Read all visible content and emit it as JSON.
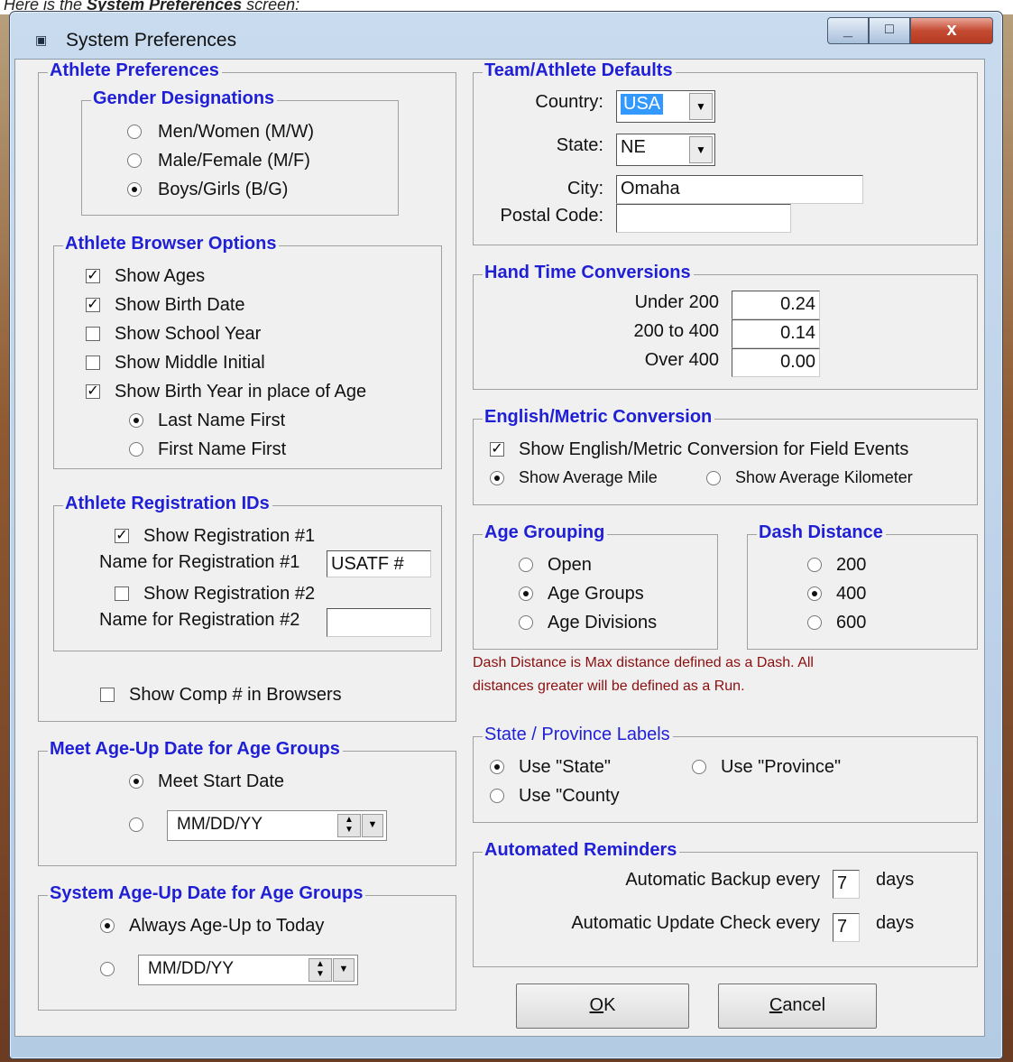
{
  "caption": {
    "prefix": "Here is the ",
    "bold": "System Preferences",
    "suffix": " screen:"
  },
  "window": {
    "title": "System Preferences",
    "title_icon": "window-icon",
    "close_glyph": "x",
    "min_glyph": "_",
    "max_glyph": "□"
  },
  "athlete_prefs": {
    "legend": "Athlete Preferences"
  },
  "gender": {
    "legend": "Gender Designations",
    "options": [
      "Men/Women (M/W)",
      "Male/Female (M/F)",
      "Boys/Girls (B/G)"
    ],
    "selected": 2
  },
  "browser": {
    "legend": "Athlete Browser Options",
    "show_ages": "Show Ages",
    "show_birth_date": "Show Birth Date",
    "show_school_year": "Show School Year",
    "show_middle_initial": "Show Middle Initial",
    "show_birth_year": "Show Birth Year in place of Age",
    "last_name_first": "Last Name First",
    "first_name_first": "First Name First"
  },
  "registration": {
    "legend": "Athlete Registration IDs",
    "show_reg1": "Show Registration #1",
    "name_reg1_label": "Name for Registration #1",
    "name_reg1_value": "USATF #",
    "show_reg2": "Show Registration #2",
    "name_reg2_label": "Name for Registration #2",
    "name_reg2_value": ""
  },
  "show_comp": "Show Comp # in Browsers",
  "meet_ageup": {
    "legend": "Meet Age-Up Date for Age Groups",
    "meet_start": "Meet Start Date",
    "date_value": "MM/DD/YY"
  },
  "system_ageup": {
    "legend": "System Age-Up Date for Age Groups",
    "always": "Always Age-Up to Today",
    "date_value": "MM/DD/YY"
  },
  "defaults": {
    "legend": "Team/Athlete Defaults",
    "country_label": "Country:",
    "country_value": "USA",
    "state_label": "State:",
    "state_value": "NE",
    "city_label": "City:",
    "city_value": "Omaha",
    "postal_label": "Postal Code:",
    "postal_value": ""
  },
  "hand_time": {
    "legend": "Hand Time Conversions",
    "under200_label": "Under 200",
    "under200_value": "0.24",
    "between_label": "200 to 400",
    "between_value": "0.14",
    "over400_label": "Over 400",
    "over400_value": "0.00"
  },
  "english_metric": {
    "legend": "English/Metric Conversion",
    "show_conversion": "Show English/Metric Conversion for Field Events",
    "avg_mile": "Show Average Mile",
    "avg_km": "Show Average Kilometer"
  },
  "age_grouping": {
    "legend": "Age Grouping",
    "open": "Open",
    "age_groups": "Age Groups",
    "age_divisions": "Age Divisions"
  },
  "dash": {
    "legend": "Dash Distance",
    "d200": "200",
    "d400": "400",
    "d600": "600",
    "note_line1": "Dash Distance is Max distance defined as a Dash.  All",
    "note_line2": "distances greater will be defined as a Run."
  },
  "state_labels": {
    "legend": "State / Province Labels",
    "use_state": "Use \"State\"",
    "use_province": "Use \"Province\"",
    "use_county": "Use \"County"
  },
  "reminders": {
    "legend": "Automated Reminders",
    "backup_label": "Automatic Backup every",
    "backup_value": "7",
    "backup_unit": "days",
    "update_label": "Automatic Update Check every",
    "update_value": "7",
    "update_unit": "days"
  },
  "buttons": {
    "ok_mnemonic": "O",
    "ok_rest": "K",
    "cancel_mnemonic": "C",
    "cancel_rest": "ancel"
  }
}
